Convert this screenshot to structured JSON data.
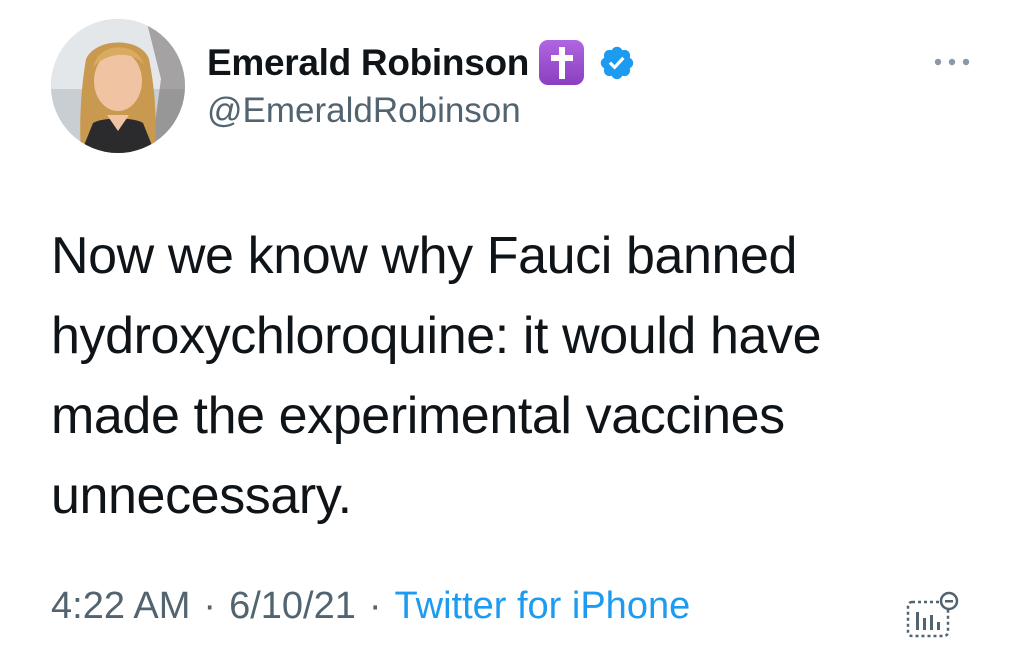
{
  "user": {
    "display_name": "Emerald Robinson",
    "handle": "@EmeraldRobinson",
    "emoji_badge": "latin-cross-emoji",
    "verified": true,
    "verified_color": "#1d9bf0",
    "avatar": "profile-photo"
  },
  "tweet": {
    "text": "Now we know why Fauci banned hydroxychloroquine: it would have made the experimental vaccines unnecessary.",
    "time": "4:22 AM",
    "date": "6/10/21",
    "source": "Twitter for iPhone",
    "separator": "·"
  },
  "icons": {
    "more": "more-options-icon",
    "analytics": "tweet-analytics-icon"
  },
  "colors": {
    "text": "#0f1419",
    "secondary": "#536471",
    "link": "#1d9bf0",
    "emoji_purple": "#9b4dca"
  }
}
